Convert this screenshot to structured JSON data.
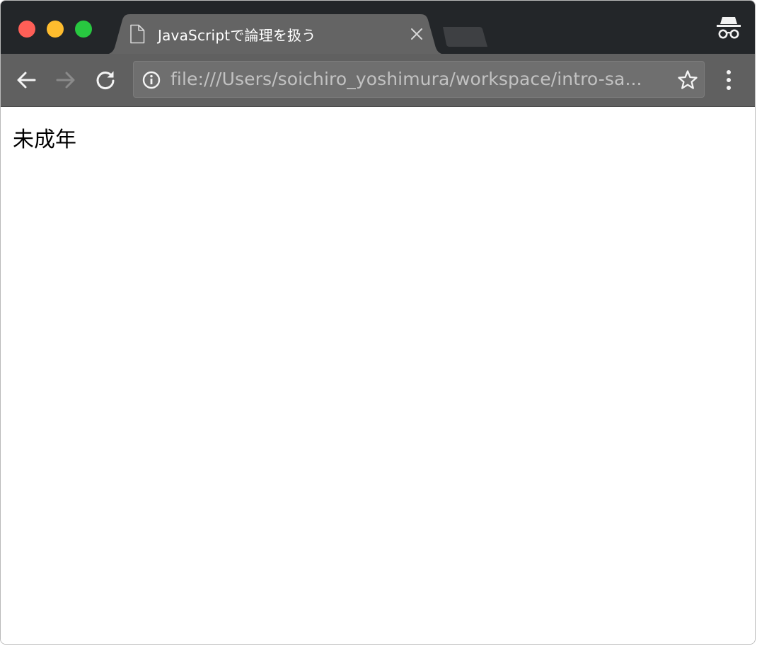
{
  "window": {
    "controls": [
      "close",
      "minimize",
      "maximize"
    ]
  },
  "tab": {
    "icon": "document-icon",
    "title": "JavaScriptで論理を扱う",
    "close_icon": "close-icon"
  },
  "new_tab_icon": "new-tab-icon",
  "incognito_icon": "incognito-icon",
  "toolbar": {
    "back_icon": "back-arrow-icon",
    "forward_icon": "forward-arrow-icon",
    "reload_icon": "reload-icon",
    "forward_enabled": false
  },
  "omnibox": {
    "security_icon": "info-icon",
    "url": "file:///Users/soichiro_yoshimura/workspace/intro-sa...",
    "bookmark_icon": "star-icon"
  },
  "menu_icon": "more-vert-icon",
  "page": {
    "text": "未成年"
  },
  "colors": {
    "titlebar": "#232629",
    "tab": "#646464",
    "toolbar": "#606060",
    "close": "#fe5f57",
    "minimize": "#febc2e",
    "maximize": "#28c840"
  }
}
